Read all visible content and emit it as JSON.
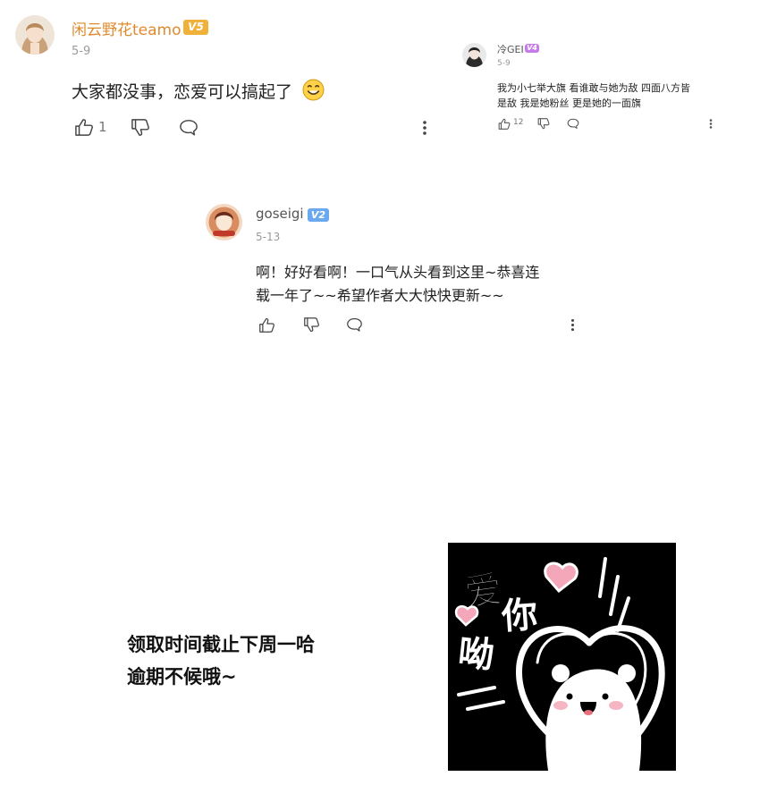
{
  "comments": [
    {
      "username": "闲云野花teamo",
      "level": "V5",
      "level_color": "#f0b13a",
      "date": "5-9",
      "text": "大家都没事，恋爱可以搞起了",
      "emoji": "smiling-face-emoji",
      "likes": "1",
      "icons": [
        "thumbs-up-icon",
        "thumbs-down-icon",
        "comment-bubble-icon",
        "more-vertical-icon"
      ]
    },
    {
      "username": "冷GEI",
      "level": "V4",
      "level_color": "#c77be8",
      "date": "5-9",
      "text_line1": "我为小七举大旗 看谁敢与她为敌 四面八方皆",
      "text_line2": "是敌 我是她粉丝 更是她的一面旗",
      "likes": "12",
      "icons": [
        "thumbs-up-icon",
        "thumbs-down-icon",
        "comment-bubble-icon",
        "more-vertical-icon"
      ]
    },
    {
      "username": "goseigi",
      "level": "V2",
      "level_color": "#6aa8f0",
      "date": "5-13",
      "text_line1": "啊！好好看啊！一口气从头看到这里~恭喜连",
      "text_line2": "载一年了~~希望作者大大快快更新~~",
      "icons": [
        "thumbs-up-icon",
        "thumbs-down-icon",
        "comment-bubble-icon",
        "more-vertical-icon"
      ]
    }
  ],
  "caption": {
    "line1": "领取时间截止下周一哈",
    "line2": "逾期不候哦~"
  },
  "sticker": {
    "chars": [
      "爱",
      "你",
      "呦"
    ],
    "background": "#000000",
    "heart_color": "#f3a7b8"
  }
}
